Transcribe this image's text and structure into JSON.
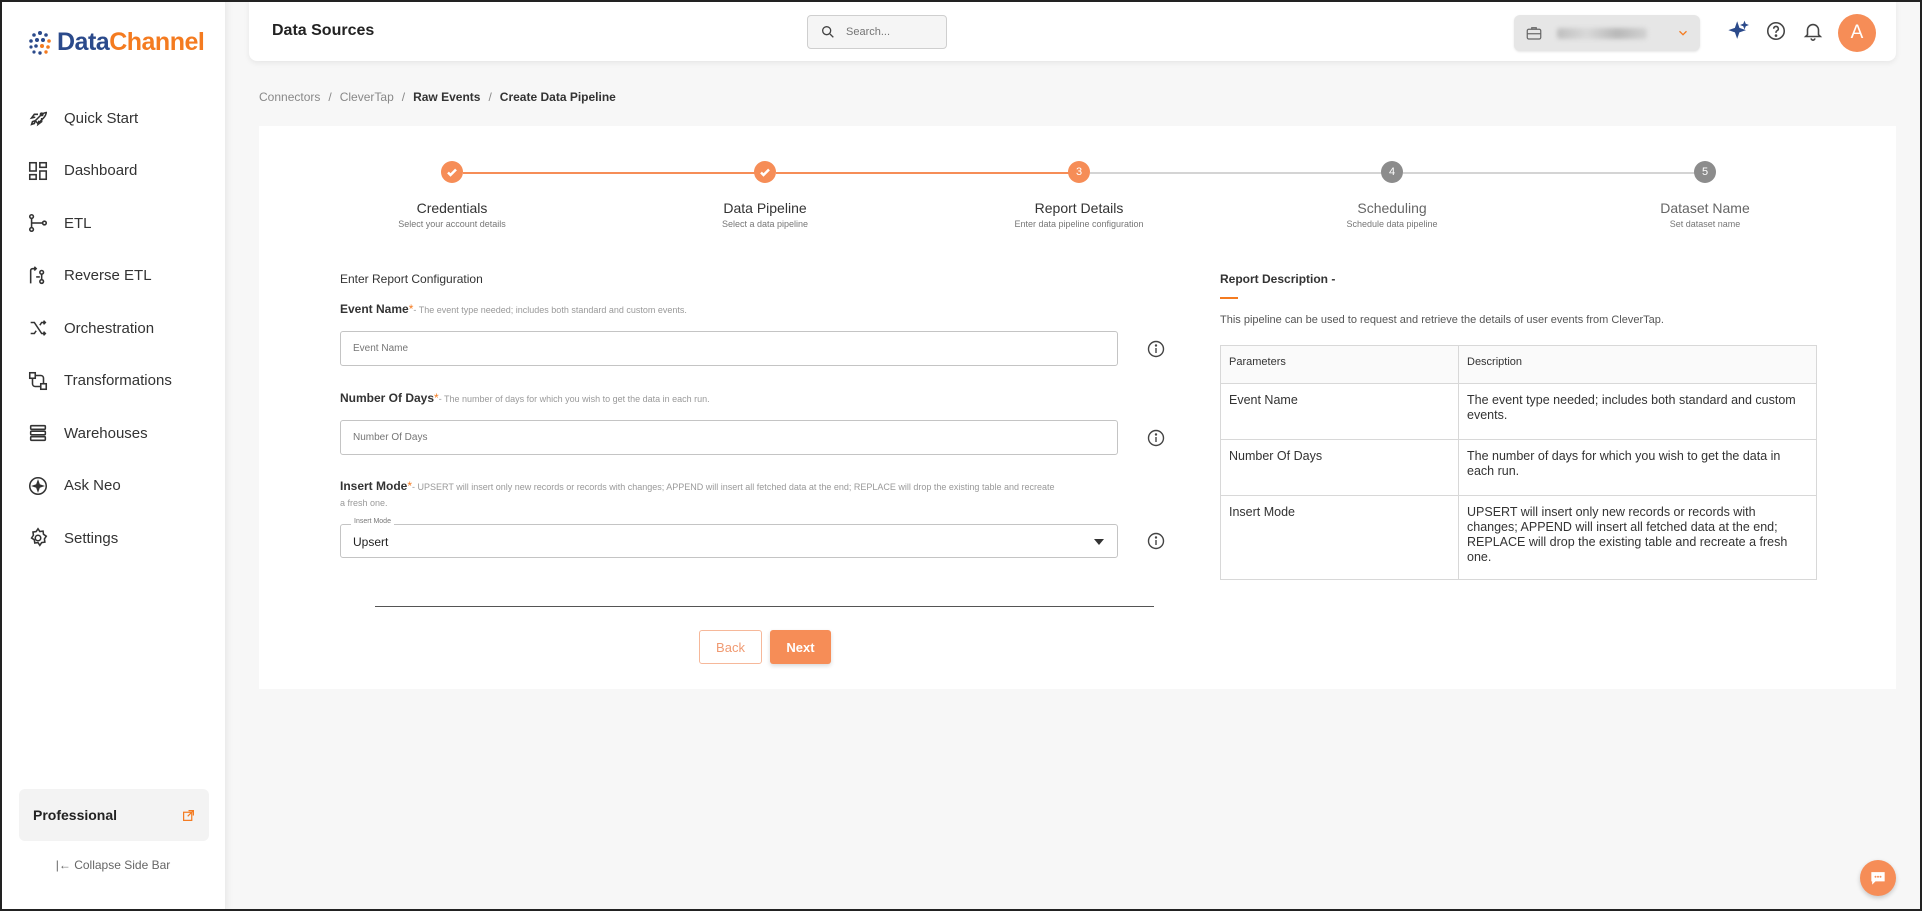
{
  "brand": {
    "part1": "Data",
    "part2": "Channel"
  },
  "sidebar": {
    "items": [
      {
        "label": "Quick Start",
        "icon": "rocket-icon"
      },
      {
        "label": "Dashboard",
        "icon": "dashboard-icon"
      },
      {
        "label": "ETL",
        "icon": "etl-icon"
      },
      {
        "label": "Reverse ETL",
        "icon": "reverse-etl-icon"
      },
      {
        "label": "Orchestration",
        "icon": "orchestration-icon"
      },
      {
        "label": "Transformations",
        "icon": "transformations-icon"
      },
      {
        "label": "Warehouses",
        "icon": "warehouses-icon"
      },
      {
        "label": "Ask Neo",
        "icon": "ask-neo-icon"
      },
      {
        "label": "Settings",
        "icon": "gear-icon"
      }
    ],
    "plan": "Professional",
    "collapse_label": "Collapse Side Bar"
  },
  "header": {
    "title": "Data Sources",
    "search_placeholder": "Search...",
    "avatar_initial": "A"
  },
  "breadcrumb": [
    "Connectors",
    "CleverTap",
    "Raw Events",
    "Create Data Pipeline"
  ],
  "stepper": [
    {
      "label": "Credentials",
      "sub": "Select your account details",
      "state": "done"
    },
    {
      "label": "Data Pipeline",
      "sub": "Select a data pipeline",
      "state": "done"
    },
    {
      "label": "Report Details",
      "sub": "Enter data pipeline configuration",
      "state": "active",
      "num": "3"
    },
    {
      "label": "Scheduling",
      "sub": "Schedule data pipeline",
      "state": "pending",
      "num": "4"
    },
    {
      "label": "Dataset Name",
      "sub": "Set dataset name",
      "state": "pending",
      "num": "5"
    }
  ],
  "form": {
    "heading": "Enter Report Configuration",
    "event_name": {
      "label": "Event Name",
      "req": "*",
      "hint": "- The event type needed; includes both standard and custom events.",
      "placeholder": "Event Name"
    },
    "days": {
      "label": "Number Of Days",
      "req": "*",
      "hint": "- The number of days for which you wish to get the data in each run.",
      "placeholder": "Number Of Days"
    },
    "insert_mode": {
      "label": "Insert Mode",
      "req": "*",
      "hint": "- UPSERT will insert only new records or records with changes; APPEND will insert all fetched data at the end; REPLACE will drop the existing table and recreate a fresh one.",
      "legend": "Insert Mode",
      "value": "Upsert"
    },
    "back": "Back",
    "next": "Next"
  },
  "description": {
    "title": "Report Description -",
    "text": "This pipeline can be used to request and retrieve the details of user events from CleverTap.",
    "headers": [
      "Parameters",
      "Description"
    ],
    "rows": [
      {
        "param": "Event Name",
        "desc": "The event type needed; includes both standard and custom events."
      },
      {
        "param": "Number Of Days",
        "desc": "The number of days for which you wish to get the data in each run."
      },
      {
        "param": "Insert Mode",
        "desc": "UPSERT will insert only new records or records with changes; APPEND will insert all fetched data at the end; REPLACE will drop the existing table and recreate a fresh one."
      }
    ]
  },
  "colors": {
    "accent": "#f68d57",
    "brand_blue": "#2b4a8b",
    "brand_orange": "#f47b20",
    "pending": "#8c8c8c"
  }
}
